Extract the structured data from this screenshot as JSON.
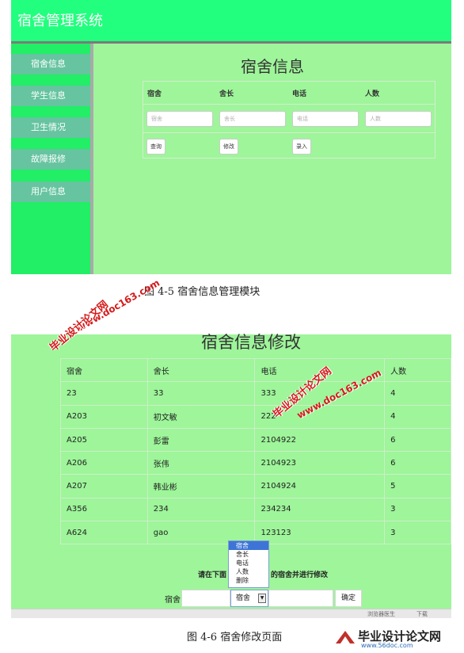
{
  "fig1": {
    "app_title": "宿舍管理系统",
    "sidebar": [
      "宿舍信息",
      "学生信息",
      "卫生情况",
      "故障报修",
      "用户信息"
    ],
    "page_title": "宿舍信息",
    "columns": [
      "宿舍",
      "舍长",
      "电话",
      "人数"
    ],
    "placeholders": [
      "宿舍",
      "舍长",
      "电话",
      "人数"
    ],
    "buttons": {
      "query": "查询",
      "modify": "修改",
      "add": "录入"
    },
    "caption": "图 4-5 宿舍信息管理模块"
  },
  "fig2": {
    "page_title": "宿舍信息修改",
    "table_headers": [
      "宿舍",
      "舍长",
      "电话",
      "人数"
    ],
    "rows": [
      [
        "23",
        "33",
        "333",
        "4"
      ],
      [
        "A203",
        "初文敏",
        "222",
        "4"
      ],
      [
        "A205",
        "彭雷",
        "2104922",
        "6"
      ],
      [
        "A206",
        "张伟",
        "2104923",
        "6"
      ],
      [
        "A207",
        "韩业彬",
        "2104924",
        "5"
      ],
      [
        "A356",
        "234",
        "234234",
        "3"
      ],
      [
        "A624",
        "gao",
        "123123",
        "3"
      ]
    ],
    "instruction_left": "请在下面",
    "instruction_right": "的宿舍并进行修改",
    "dropdown_options": [
      "宿舍",
      "舍长",
      "电话",
      "人数",
      "删除"
    ],
    "selected_option": "宿舍",
    "field_label": "宿舍",
    "select_value": "宿舍",
    "confirm_label": "确定",
    "statusbar_left": "浏览器医生",
    "statusbar_mid": "下载",
    "caption": "图 4-6 宿舍修改页面"
  },
  "watermarks": {
    "cn": "毕业设计论文网",
    "url": "www.doc163.com",
    "logo_cn": "毕业设计论文网",
    "logo_url": "www.56doc.com"
  },
  "colors": {
    "page_bg": "#9ef59a",
    "header": "#22ff7e",
    "sidebar": "#22ee66",
    "sidebar_item": "#66c4a0",
    "watermark": "#d41a1a"
  }
}
